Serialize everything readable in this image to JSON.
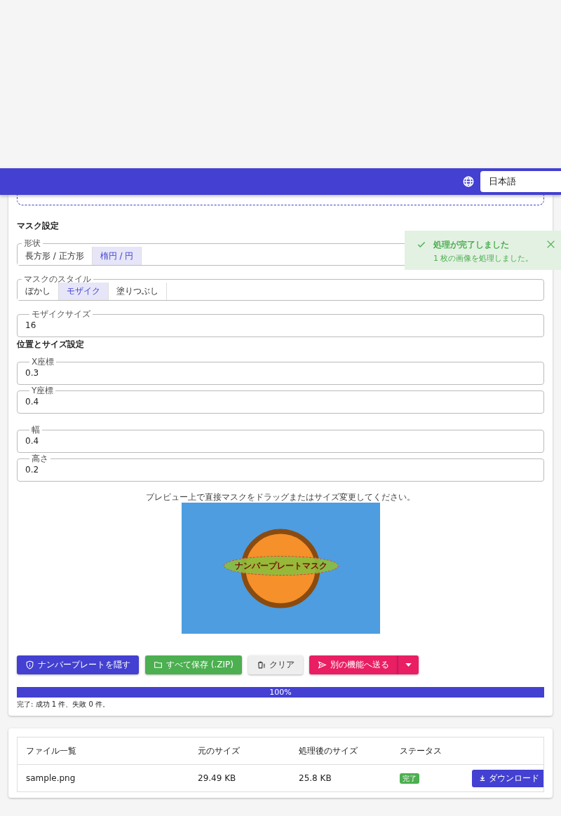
{
  "app_bar": {
    "language": "日本語"
  },
  "mask_settings": {
    "title": "マスク設定",
    "shape": {
      "label": "形状",
      "options": [
        {
          "label": "長方形 / 正方形",
          "selected": false
        },
        {
          "label": "楕円 / 円",
          "selected": true
        }
      ]
    },
    "style": {
      "label": "マスクのスタイル",
      "options": [
        {
          "label": "ぼかし",
          "selected": false
        },
        {
          "label": "モザイク",
          "selected": true
        },
        {
          "label": "塗りつぶし",
          "selected": false
        }
      ]
    },
    "mosaic_size": {
      "label": "モザイクサイズ",
      "value": "16"
    }
  },
  "position": {
    "title": "位置とサイズ設定",
    "fields": [
      {
        "label": "X座標",
        "value": "0.3"
      },
      {
        "label": "Y座標",
        "value": "0.4"
      },
      {
        "label": "幅",
        "value": "0.4"
      },
      {
        "label": "高さ",
        "value": "0.2"
      }
    ]
  },
  "preview": {
    "hint": "プレビュー上で直接マスクをドラッグまたはサイズ変更してください。",
    "mask_label": "ナンバープレートマスク"
  },
  "actions": [
    {
      "kind": "primary",
      "label": "ナンバープレートを隠す"
    },
    {
      "kind": "save",
      "label": "すべて保存 (.ZIP)"
    },
    {
      "kind": "clear",
      "label": "クリア"
    },
    {
      "kind": "send",
      "label": "別の機能へ送る"
    }
  ],
  "progress": {
    "level": 1,
    "reading": "100%"
  },
  "summary": "完了: 成功 1 件、失敗 0 件。",
  "toast": {
    "title": "処理が完了しました",
    "message": "1 枚の画像を処理しました。"
  },
  "files": {
    "columns": [
      "ファイル一覧",
      "元のサイズ",
      "処理後のサイズ",
      "ステータス"
    ],
    "rows": [
      {
        "name": "sample.png",
        "original": "29.49 KB",
        "processed": "25.8 KB",
        "status": "完了",
        "action": "ダウンロード"
      }
    ]
  }
}
